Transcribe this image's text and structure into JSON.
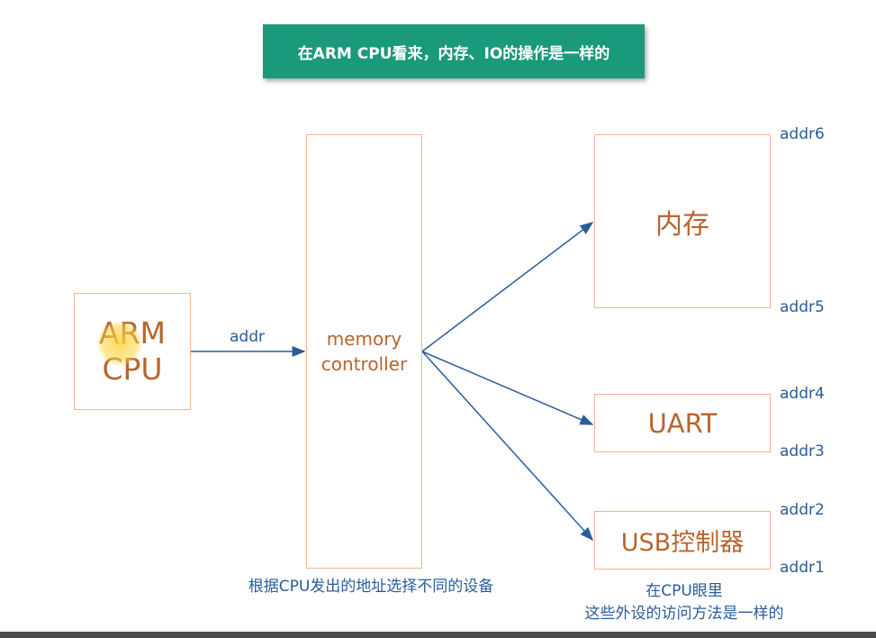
{
  "banner": {
    "title": "在ARM CPU看来，内存、IO的操作是一样的"
  },
  "cpu": {
    "line1": "ARM",
    "line2": "CPU"
  },
  "bus_label": "addr",
  "memory_controller": {
    "line1": "memory",
    "line2": "controller"
  },
  "devices": {
    "memory": "内存",
    "uart": "UART",
    "usb": "USB控制器"
  },
  "addresses": {
    "addr6": "addr6",
    "addr5": "addr5",
    "addr4": "addr4",
    "addr3": "addr3",
    "addr2": "addr2",
    "addr1": "addr1"
  },
  "notes": {
    "controller_note": "根据CPU发出的地址选择不同的设备",
    "cpu_view_line1": "在CPU眼里",
    "cpu_view_line2": "这些外设的访问方法是一样的"
  },
  "colors": {
    "banner_bg": "#1a9a7a",
    "box_border": "#f0b49a",
    "box_text": "#b8642e",
    "arrow": "#2a5c9a",
    "label_text": "#2a5c9a"
  }
}
